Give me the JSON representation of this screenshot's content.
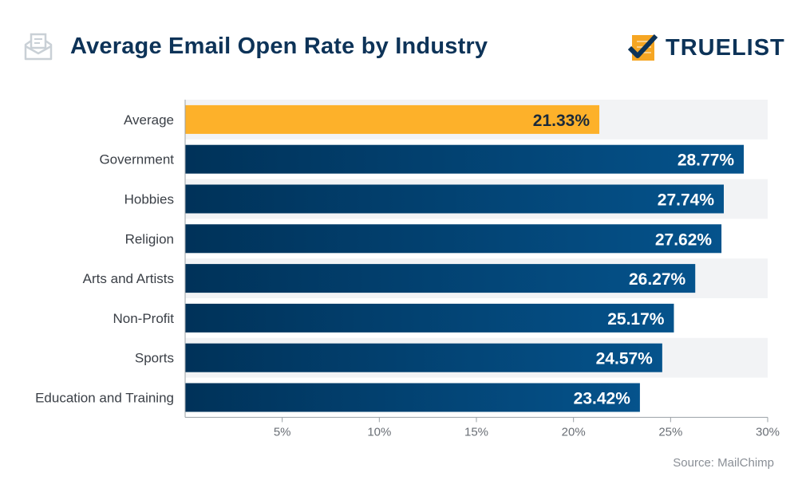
{
  "header": {
    "title": "Average Email Open Rate by Industry",
    "icon": "envelope-open-icon",
    "logo_text": "TRUELIST",
    "logo_icon": "checklist-icon"
  },
  "footer": {
    "source": "Source: MailChimp"
  },
  "colors": {
    "highlight_bar": "#fdb12a",
    "bar_dark": "#003259",
    "bar_light": "#05538c",
    "row_bg": "#f2f3f5",
    "title": "#0d3358",
    "highlight_text": "#1b2a3a",
    "value_text": "#ffffff"
  },
  "chart_data": {
    "type": "bar",
    "orientation": "horizontal",
    "title": "Average Email Open Rate by Industry",
    "xlabel": "",
    "ylabel": "",
    "categories": [
      "Average",
      "Government",
      "Hobbies",
      "Religion",
      "Arts and Artists",
      "Non-Profit",
      "Sports",
      "Education and Training"
    ],
    "values": [
      21.33,
      28.77,
      27.74,
      27.62,
      26.27,
      25.17,
      24.57,
      23.42
    ],
    "value_labels": [
      "21.33%",
      "28.77%",
      "27.74%",
      "27.62%",
      "26.27%",
      "25.17%",
      "24.57%",
      "23.42%"
    ],
    "highlighted": [
      "Average"
    ],
    "xlim": [
      0,
      30
    ],
    "xticks": [
      5,
      10,
      15,
      20,
      25,
      30
    ],
    "xtick_labels": [
      "5%",
      "10%",
      "15%",
      "20%",
      "25%",
      "30%"
    ],
    "grid": false,
    "legend": "none",
    "source": "Source: MailChimp"
  }
}
